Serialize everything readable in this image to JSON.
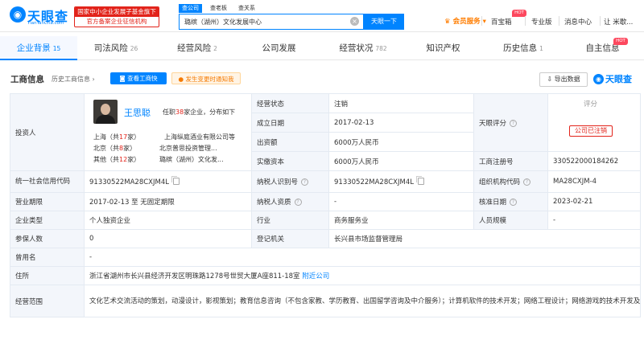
{
  "header": {
    "logo_name": "天眼查",
    "logo_sub": "TianYanCha.com",
    "badge_line1": "国家中小企业发展子基金旗下",
    "badge_line2": "官方备案企业征信机构",
    "search_tabs": [
      "查公司",
      "查老板",
      "查关系"
    ],
    "search_value": "璐缤（湖州）文化发展中心",
    "search_button": "天眼一下",
    "member": "会员服务",
    "nav": [
      "百宝箱",
      "专业版",
      "消息中心",
      "让 米歇..."
    ],
    "hot_label": "HOT"
  },
  "tabs": [
    {
      "label": "企业背景",
      "count": "15"
    },
    {
      "label": "司法风险",
      "count": "26"
    },
    {
      "label": "经营风险",
      "count": "2"
    },
    {
      "label": "公司发展",
      "count": ""
    },
    {
      "label": "经营状况",
      "count": "782"
    },
    {
      "label": "知识产权",
      "count": ""
    },
    {
      "label": "历史信息",
      "count": "1"
    },
    {
      "label": "自主信息",
      "count": ""
    }
  ],
  "section": {
    "title": "工商信息",
    "history": "历史工商信息",
    "history_count": "›",
    "view_btn": "查看工商快",
    "alert_btn": "发生变更时通知我",
    "export_btn": "导出数据",
    "brand": "天眼查"
  },
  "info": {
    "investor_label": "投资人",
    "person_name": "王思聪",
    "person_desc_pre": "任职",
    "person_count": "38",
    "person_desc_post": "家企业，分布如下",
    "dist": [
      {
        "city": "上海",
        "count_pre": "（共",
        "count": "17",
        "count_post": "家）",
        "company": "上海纵庭酒业有限公司等"
      },
      {
        "city": "北京",
        "count_pre": "（共",
        "count": "8",
        "count_post": "家）",
        "company": "北京普思投资管理..."
      },
      {
        "city": "其他",
        "count_pre": "（共",
        "count": "12",
        "count_post": "家）",
        "company": "璐缤（湖州）文化发..."
      }
    ],
    "status_label": "经营状态",
    "status_value": "注销",
    "found_label": "成立日期",
    "found_value": "2017-02-13",
    "capital_label": "出资额",
    "capital_value": "6000万人民币",
    "paid_label": "实缴资本",
    "paid_value": "6000万人民币",
    "rating_label": "天眼评分",
    "rating_value": "评分",
    "stamp": "公司已注销",
    "reg_no_label": "工商注册号",
    "reg_no_value": "330522000184262",
    "credit_label": "统一社会信用代码",
    "credit_value": "91330522MA28CXJM4L",
    "tax_label": "纳税人识别号",
    "tax_value": "91330522MA28CXJM4L",
    "org_label": "组织机构代码",
    "org_value": "MA28CXJM-4",
    "term_label": "营业期限",
    "term_value": "2017-02-13 至 无固定期限",
    "tax_qual_label": "纳税人资质",
    "tax_qual_value": "-",
    "approve_label": "核准日期",
    "approve_value": "2023-02-21",
    "type_label": "企业类型",
    "type_value": "个人独资企业",
    "industry_label": "行业",
    "industry_value": "商务服务业",
    "size_label": "人员规模",
    "size_value": "-",
    "insured_label": "参保人数",
    "insured_value": "0",
    "authority_label": "登记机关",
    "authority_value": "长兴县市场监督管理局",
    "former_label": "曾用名",
    "former_value": "-",
    "address_label": "住所",
    "address_value": "浙江省湖州市长兴县经济开发区明珠路1278号世贸大厦A座811-18室",
    "nearby": "附近公司",
    "scope_label": "经营范围",
    "scope_value": "文化艺术交流活动的策划，动漫设计，影视策划；教育信息咨询（不包含家教、学历教育、出国留学咨询及中介服务）；计算机软件的技术开发；网络工程设计；网络游戏的技术开发及设计，企业管理服务；电子产品、服装、工艺品（除文物、古玩、字画、邮品）、日用百货销售。"
  }
}
